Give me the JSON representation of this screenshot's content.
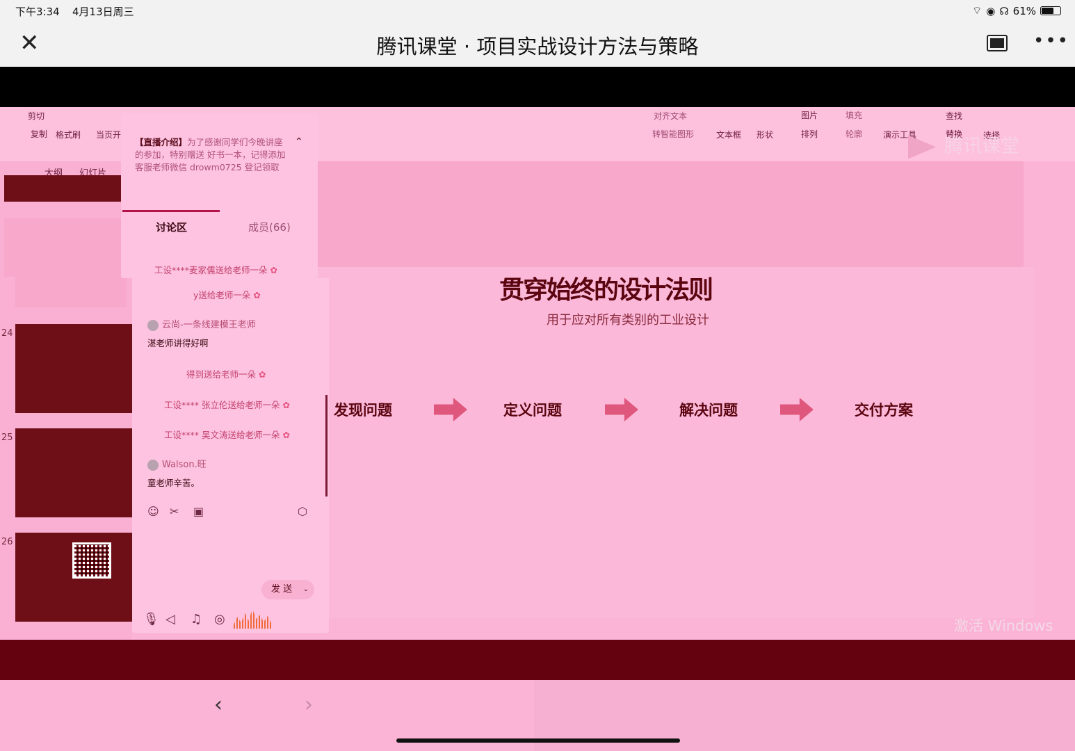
{
  "status_bar": {
    "time": "下午3:34",
    "date": "4月13日周三",
    "battery": "61%"
  },
  "header": {
    "title": "腾讯课堂 · 项目实战设计方法与策略"
  },
  "ribbon": {
    "cut": "剪切",
    "copy": "复制",
    "format_painter": "格式刷",
    "current_page": "当页开",
    "align_text": "对齐文本",
    "smart_shape": "转智能图形",
    "text_box": "文本框",
    "shape": "形状",
    "arrange": "排列",
    "picture": "图片",
    "fill": "填充",
    "outline": "轮廓",
    "present_tools": "演示工具",
    "find": "查找",
    "replace": "替换",
    "select": "选择"
  },
  "watermark": "腾讯课堂",
  "left_pane": {
    "tabs": [
      "大纲",
      "幻灯片"
    ],
    "slide_numbers": [
      "24",
      "25",
      "26"
    ]
  },
  "slide": {
    "title": "贯穿始终的设计法则",
    "subtitle": "用于应对所有类别的工业设计",
    "steps": [
      "发现问题",
      "定义问题",
      "解决问题",
      "交付方案"
    ]
  },
  "windows_notice": "激活 Windows",
  "chat": {
    "intro_label": "【直播介绍】",
    "intro_text": "为了感谢同学们今晚讲座的参加，特别赠送 好书一本，记得添加客服老师微信 drowm0725 登记领取",
    "tab_discussion": "讨论区",
    "tab_members": "成员(66)",
    "messages": [
      {
        "type": "gift",
        "text": "工设****麦家儒送给老师一朵"
      },
      {
        "type": "gift",
        "text": "y送给老师一朵"
      },
      {
        "type": "user",
        "name": "云尚-一条线建模王老师",
        "text": "湛老师讲得好啊"
      },
      {
        "type": "gift",
        "text": "得到送给老师一朵"
      },
      {
        "type": "gift",
        "text": "工设**** 张立伦送给老师一朵"
      },
      {
        "type": "gift",
        "text": "工设**** 吴文涛送给老师一朵"
      },
      {
        "type": "user",
        "name": "Walson.旺",
        "text": "童老师辛苦。"
      }
    ],
    "send_label": "发 送"
  },
  "colors": {
    "accent": "#b3124a",
    "slide_bg": "#fbb8d8",
    "maroon": "#65020f"
  }
}
